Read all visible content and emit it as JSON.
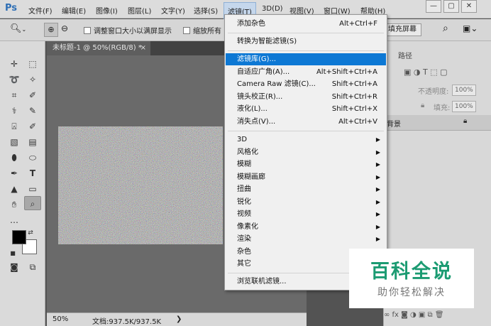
{
  "menubar": {
    "logo": "Ps",
    "items": [
      {
        "label": "文件(F)"
      },
      {
        "label": "编辑(E)"
      },
      {
        "label": "图像(I)"
      },
      {
        "label": "图层(L)"
      },
      {
        "label": "文字(Y)"
      },
      {
        "label": "选择(S)"
      },
      {
        "label": "滤镜(T)",
        "active": true
      },
      {
        "label": "3D(D)"
      },
      {
        "label": "视图(V)"
      },
      {
        "label": "窗口(W)"
      },
      {
        "label": "帮助(H)"
      }
    ],
    "window_buttons": {
      "minimize": "—",
      "restore": "▢",
      "close": "✕"
    }
  },
  "options_bar": {
    "resize_windows_label": "调整窗口大小以满屏显示",
    "zoom_all_label": "缩放所有",
    "fill_screen_button": "填充屏幕"
  },
  "document": {
    "tab_title": "未标题-1 @ 50%(RGB/8) *",
    "tab_close": "×"
  },
  "status": {
    "zoom": "50%",
    "doc_size": "文档:937.5K/937.5K"
  },
  "right_panel": {
    "paths_tab": "路径",
    "opacity_label": "不透明度:",
    "opacity_value": "100%",
    "fill_label": "填充:",
    "fill_value": "100%",
    "background_layer": "背景"
  },
  "filter_menu": {
    "items": [
      {
        "label": "添加杂色",
        "shortcut": "Alt+Ctrl+F"
      },
      {
        "label": "转换为智能滤镜(S)",
        "shortcut": ""
      },
      {
        "label": "滤镜库(G)...",
        "shortcut": "",
        "highlighted": true
      },
      {
        "label": "自适应广角(A)...",
        "shortcut": "Alt+Shift+Ctrl+A"
      },
      {
        "label": "Camera Raw 滤镜(C)...",
        "shortcut": "Shift+Ctrl+A"
      },
      {
        "label": "镜头校正(R)...",
        "shortcut": "Shift+Ctrl+R"
      },
      {
        "label": "液化(L)...",
        "shortcut": "Shift+Ctrl+X"
      },
      {
        "label": "消失点(V)...",
        "shortcut": "Alt+Ctrl+V"
      },
      {
        "label": "3D",
        "submenu": true
      },
      {
        "label": "风格化",
        "submenu": true
      },
      {
        "label": "模糊",
        "submenu": true
      },
      {
        "label": "模糊画廊",
        "submenu": true
      },
      {
        "label": "扭曲",
        "submenu": true
      },
      {
        "label": "锐化",
        "submenu": true
      },
      {
        "label": "视频",
        "submenu": true
      },
      {
        "label": "像素化",
        "submenu": true
      },
      {
        "label": "渲染",
        "submenu": true
      },
      {
        "label": "杂色",
        "submenu": true
      },
      {
        "label": "其它",
        "submenu": true
      },
      {
        "label": "浏览联机滤镜...",
        "shortcut": ""
      }
    ]
  },
  "watermark": {
    "title": "百科全说",
    "subtitle": "助你轻松解决"
  },
  "colors": {
    "menu_highlight": "#0d78d4",
    "watermark_green": "#1b9b72",
    "workspace": "#6a6a6a"
  },
  "icons": [
    "zoom-in-icon",
    "zoom-out-icon",
    "search-icon",
    "move-icon",
    "marquee-icon",
    "lasso-icon",
    "magic-wand-icon",
    "eyedropper-icon",
    "healing-brush-icon",
    "brush-icon",
    "stamp-icon",
    "history-brush-icon",
    "eraser-icon",
    "gradient-icon",
    "blur-icon",
    "dodge-icon",
    "pen-icon",
    "type-icon",
    "path-select-icon",
    "rectangle-icon",
    "hand-icon",
    "zoom-tool-icon",
    "more-tools-icon",
    "swap-colors-icon",
    "default-colors-icon",
    "quick-mask-icon",
    "screen-mode-icon",
    "lock-icon"
  ]
}
